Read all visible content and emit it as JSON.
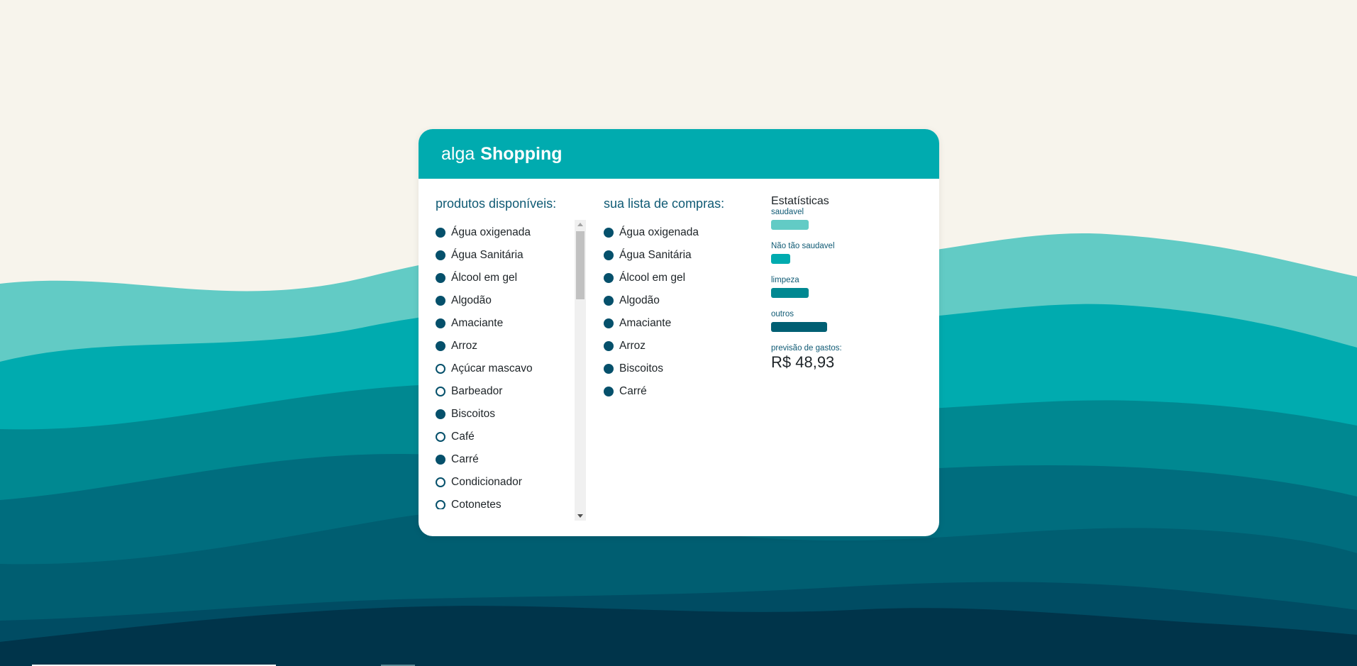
{
  "header": {
    "brand_light": "alga",
    "brand_bold": "Shopping"
  },
  "available": {
    "title": "produtos disponíveis:",
    "items": [
      {
        "label": "Água oxigenada",
        "selected": true
      },
      {
        "label": "Água Sanitária",
        "selected": true
      },
      {
        "label": "Álcool em gel",
        "selected": true
      },
      {
        "label": "Algodão",
        "selected": true
      },
      {
        "label": "Amaciante",
        "selected": true
      },
      {
        "label": "Arroz",
        "selected": true
      },
      {
        "label": "Açúcar mascavo",
        "selected": false
      },
      {
        "label": "Barbeador",
        "selected": false
      },
      {
        "label": "Biscoitos",
        "selected": true
      },
      {
        "label": "Café",
        "selected": false
      },
      {
        "label": "Carré",
        "selected": true
      },
      {
        "label": "Condicionador",
        "selected": false
      },
      {
        "label": "Cotonetes",
        "selected": false
      }
    ]
  },
  "shopping_list": {
    "title": "sua lista de compras:",
    "items": [
      {
        "label": "Água oxigenada"
      },
      {
        "label": "Água Sanitária"
      },
      {
        "label": "Álcool em gel"
      },
      {
        "label": "Algodão"
      },
      {
        "label": "Amaciante"
      },
      {
        "label": "Arroz"
      },
      {
        "label": "Biscoitos"
      },
      {
        "label": "Carré"
      }
    ]
  },
  "stats": {
    "title": "Estatísticas",
    "categories": [
      {
        "label": "saudavel",
        "count": 2,
        "color": "#62cbc5"
      },
      {
        "label": "Não tão saudavel",
        "count": 1,
        "color": "#00abaf"
      },
      {
        "label": "limpeza",
        "count": 2,
        "color": "#008891"
      },
      {
        "label": "outros",
        "count": 3,
        "color": "#005f73"
      }
    ],
    "forecast_label": "previsão de gastos:",
    "forecast_value": "R$ 48,93"
  },
  "colors": {
    "background": "#f7f4ec",
    "header": "#00abaf",
    "bullet": "#05506b",
    "waves": [
      "#62cbc5",
      "#00abaf",
      "#008891",
      "#006d7e",
      "#005e71",
      "#004c63",
      "#00344a"
    ]
  }
}
